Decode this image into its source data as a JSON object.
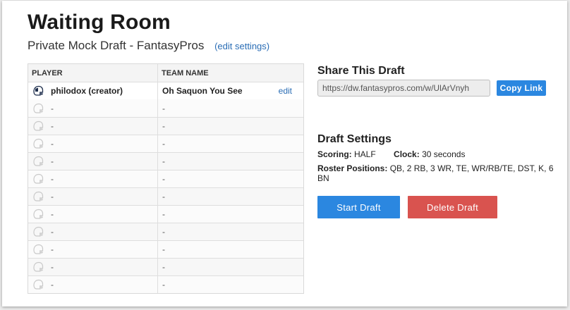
{
  "page": {
    "title": "Waiting Room",
    "subtitle": "Private Mock Draft - FantasyPros",
    "edit_settings_label": "(edit settings)"
  },
  "table": {
    "col_player": "PLAYER",
    "col_team": "TEAM NAME",
    "creator": {
      "player": "philodox (creator)",
      "team": "Oh Saquon You See",
      "edit_label": "edit"
    },
    "empty_rows": [
      {
        "player": "-",
        "team": "-"
      },
      {
        "player": "-",
        "team": "-"
      },
      {
        "player": "-",
        "team": "-"
      },
      {
        "player": "-",
        "team": "-"
      },
      {
        "player": "-",
        "team": "-"
      },
      {
        "player": "-",
        "team": "-"
      },
      {
        "player": "-",
        "team": "-"
      },
      {
        "player": "-",
        "team": "-"
      },
      {
        "player": "-",
        "team": "-"
      },
      {
        "player": "-",
        "team": "-"
      },
      {
        "player": "-",
        "team": "-"
      }
    ]
  },
  "share": {
    "title": "Share This Draft",
    "link_value": "https://dw.fantasypros.com/w/UlArVnyh",
    "copy_label": "Copy Link"
  },
  "settings": {
    "title": "Draft Settings",
    "scoring_label": "Scoring:",
    "scoring_value": "HALF",
    "clock_label": "Clock:",
    "clock_value": "30 seconds",
    "roster_label": "Roster Positions:",
    "roster_value": "QB, 2 RB, 3 WR, TE, WR/RB/TE, DST, K, 6 BN"
  },
  "actions": {
    "start_label": "Start Draft",
    "delete_label": "Delete Draft"
  },
  "colors": {
    "primary": "#2b87e0",
    "danger": "#d9534f",
    "link": "#2a6db5"
  },
  "icons": {
    "creator_avatar": "football-helmet-icon",
    "empty_avatar": "football-helmet-outline-icon"
  }
}
